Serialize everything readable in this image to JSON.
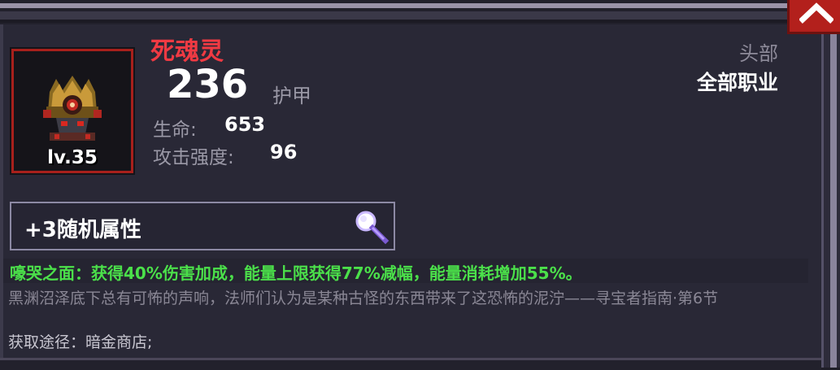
{
  "item": {
    "name": "死魂灵",
    "level": "lv.35",
    "armor_value": "236",
    "armor_label": "护甲",
    "slot": "头部",
    "class_restriction": "全部职业"
  },
  "stats": [
    {
      "label": "生命:",
      "value": "653"
    },
    {
      "label": "攻击强度:",
      "value": "96"
    }
  ],
  "random_attributes": {
    "label": "+3随机属性",
    "icon": "magnifier-icon"
  },
  "effect_text": "嚎哭之面：获得40%伤害加成，能量上限获得77%减幅，能量消耗增加55%。",
  "lore_text": "黑渊沼泽底下总有可怖的声响，法师们认为是某种古怪的东西带来了这恐怖的泥泞——寻宝者指南·第6节",
  "source_text": "获取途径：暗金商店;",
  "colors": {
    "name": "#f03a43",
    "effect": "#4be04a",
    "rarity_border": "#a8201c",
    "collapse_button": "#b3201c"
  },
  "icons": {
    "collapse": "chevron-up-icon",
    "item": "helmet-icon"
  }
}
